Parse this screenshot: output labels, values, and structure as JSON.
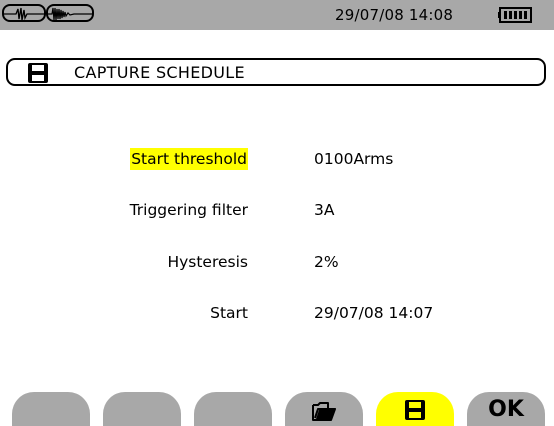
{
  "status_bar": {
    "datetime": "29/07/08 14:08"
  },
  "header": {
    "title": "CAPTURE SCHEDULE",
    "icon": "floppy-disk-icon"
  },
  "settings": [
    {
      "label": "Start threshold",
      "value": "0100Arms",
      "selected": true
    },
    {
      "label": "Triggering filter",
      "value": "3A",
      "selected": false
    },
    {
      "label": "Hysteresis",
      "value": "2%",
      "selected": false
    },
    {
      "label": "Start",
      "value": "29/07/08 14:07",
      "selected": false
    }
  ],
  "softkeys": [
    {
      "icon": "blank",
      "active": false
    },
    {
      "icon": "blank",
      "active": false
    },
    {
      "icon": "blank",
      "active": false
    },
    {
      "icon": "open-folder-icon",
      "active": false
    },
    {
      "icon": "floppy-disk-icon",
      "active": true
    },
    {
      "icon": "ok",
      "label": "OK",
      "active": false
    }
  ],
  "colors": {
    "bar_gray": "#a8a8a8",
    "highlight_yellow": "#ffff00"
  }
}
